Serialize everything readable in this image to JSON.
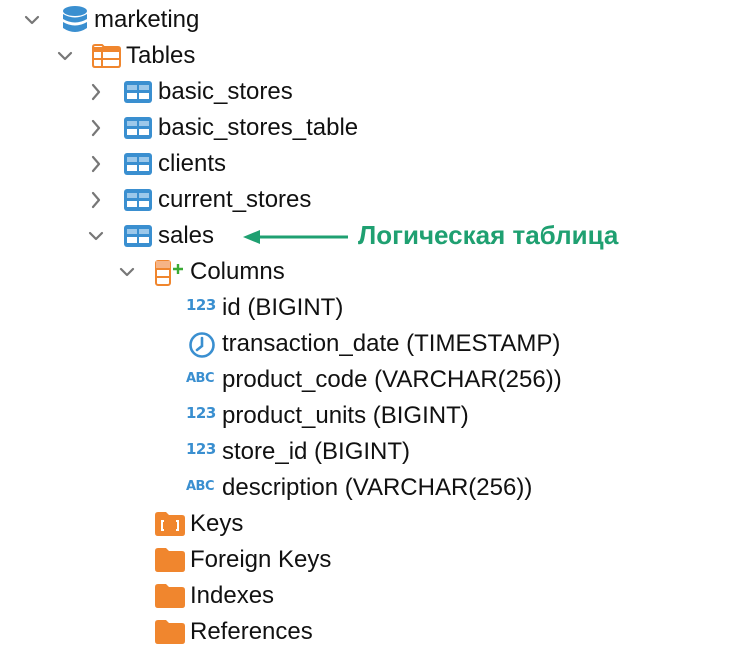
{
  "tree": {
    "database": "marketing",
    "tables_folder": "Tables",
    "tables": [
      "basic_stores",
      "basic_stores_table",
      "clients",
      "current_stores",
      "sales"
    ],
    "columns_folder": "Columns",
    "columns": [
      {
        "name": "id (BIGINT)",
        "type_icon": "123"
      },
      {
        "name": "transaction_date (TIMESTAMP)",
        "type_icon": "clock"
      },
      {
        "name": "product_code (VARCHAR(256))",
        "type_icon": "ABC"
      },
      {
        "name": "product_units (BIGINT)",
        "type_icon": "123"
      },
      {
        "name": "store_id (BIGINT)",
        "type_icon": "123"
      },
      {
        "name": "description (VARCHAR(256))",
        "type_icon": "ABC"
      }
    ],
    "folders": [
      "Keys",
      "Foreign Keys",
      "Indexes",
      "References"
    ]
  },
  "annotation": {
    "text": "Логическая таблица",
    "color": "#1fa071"
  },
  "colors": {
    "blue": "#3a8fd0",
    "orange": "#f0862e",
    "green_plus": "#3aaa35"
  }
}
